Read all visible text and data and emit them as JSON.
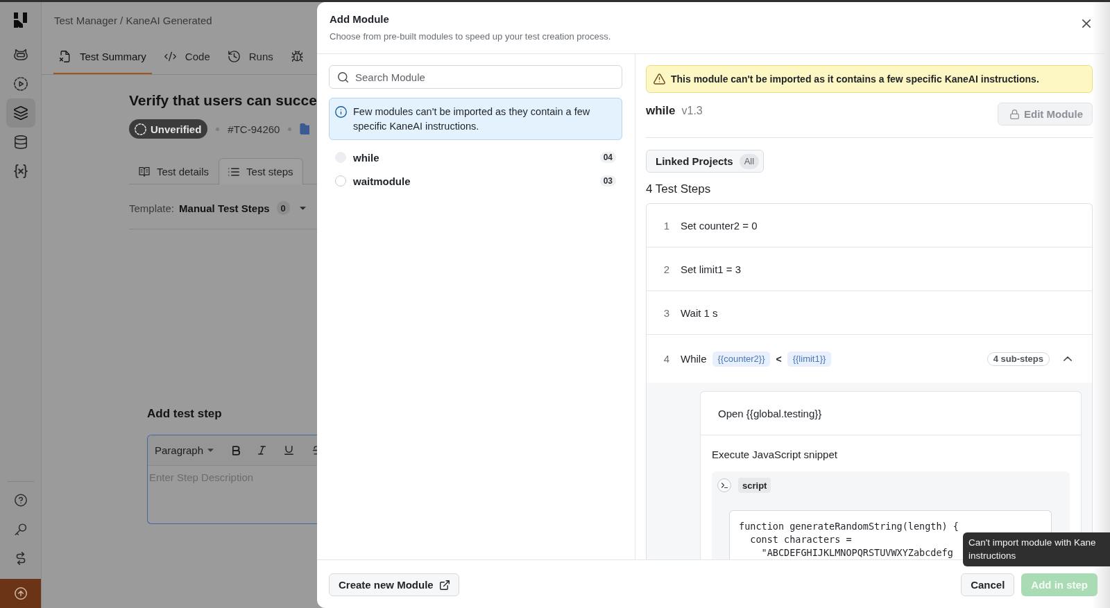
{
  "sidebar": {
    "items": [
      {
        "selected": false
      },
      {
        "selected": false
      },
      {
        "selected": true
      },
      {
        "selected": false
      },
      {
        "selected": false
      }
    ]
  },
  "header": {
    "breadcrumb": "Test Manager / KaneAI Generated",
    "tabs": [
      {
        "label": "Test Summary",
        "selected": true
      },
      {
        "label": "Code",
        "selected": false
      },
      {
        "label": "Runs",
        "selected": false
      },
      {
        "selected": false
      }
    ]
  },
  "test_case": {
    "title": "Verify that users can succe",
    "status": "Unverified",
    "id": "#TC-94260",
    "sub_tabs": [
      {
        "label": "Test details",
        "selected": false
      },
      {
        "label": "Test steps",
        "selected": true
      }
    ],
    "template": {
      "label": "Template:",
      "value": "Manual Test Steps",
      "count": "0"
    },
    "add_step": {
      "heading": "Add test step",
      "format": "Paragraph",
      "placeholder": "Enter Step Description"
    }
  },
  "dialog": {
    "title": "Add Module",
    "subtitle": "Choose from pre-built modules to speed up your test creation process.",
    "search": {
      "placeholder": "Search Module"
    },
    "info": "Few modules can't be imported as they contain a few specific KaneAI instructions.",
    "modules": [
      {
        "name": "while",
        "count": "04",
        "disabled": true
      },
      {
        "name": "waitmodule",
        "count": "03",
        "disabled": false
      }
    ],
    "warning": "This module can't be imported as it contains a few specific KaneAI instructions.",
    "module": {
      "name": "while",
      "version": "v1.3",
      "edit_button": {
        "label": "Edit Module",
        "disabled": true
      },
      "linked_projects": {
        "label": "Linked Projects",
        "badge": "All"
      },
      "steps_heading": "4 Test Steps",
      "steps": [
        {
          "kind": "text",
          "number": "1",
          "text": "Set counter2 = 0"
        },
        {
          "kind": "text",
          "number": "2",
          "text": "Set limit1 = 3"
        },
        {
          "kind": "text",
          "number": "3",
          "text": "Wait 1 s"
        },
        {
          "kind": "while",
          "number": "4",
          "text": "While",
          "condition": [
            {
              "kind": "variable",
              "text": "{{counter2}}"
            },
            {
              "kind": "operator",
              "text": "<"
            },
            {
              "kind": "variable",
              "text": "{{limit1}}"
            }
          ],
          "badge": "4 sub-steps",
          "expanded": true,
          "children": [
            {
              "kind": "text",
              "text": "Open {{global.testing}}"
            },
            {
              "kind": "script",
              "text": "Execute JavaScript snippet",
              "label": "script",
              "code": [
                "function generateRandomString(length) {",
                "  const characters =",
                "    \"ABCDEFGHIJKLMNOPQRSTUVWXYZabcdefg"
              ]
            }
          ]
        }
      ]
    },
    "footer": {
      "create_button": "Create new Module",
      "cancel_button": "Cancel",
      "add_button": {
        "label": "Add in step",
        "disabled": true
      }
    }
  },
  "tooltip": {
    "text": "Can't import module with Kane instructions"
  }
}
